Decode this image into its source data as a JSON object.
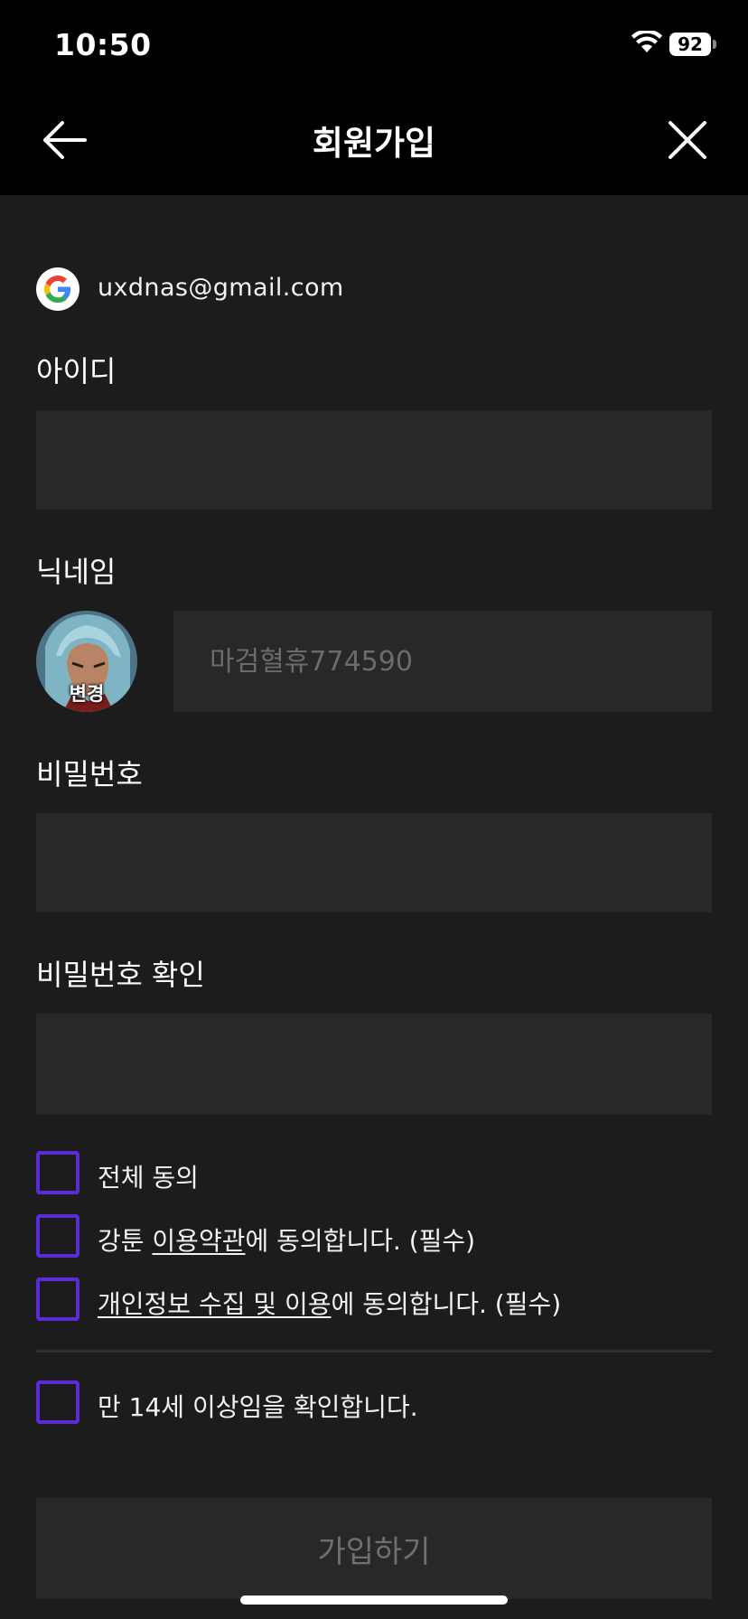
{
  "status": {
    "time": "10:50",
    "battery": "92"
  },
  "nav": {
    "title": "회원가입"
  },
  "account": {
    "email": "uxdnas@gmail.com"
  },
  "fields": {
    "id_label": "아이디",
    "nickname_label": "닉네임",
    "nickname_placeholder": "마검혈휴774590",
    "avatar_change": "변경",
    "password_label": "비밀번호",
    "password_confirm_label": "비밀번호 확인"
  },
  "agreements": {
    "all": "전체 동의",
    "terms_prefix": "강툰 ",
    "terms_link": "이용약관",
    "terms_suffix": "에 동의합니다. (필수)",
    "privacy_link": "개인정보 수집 및 이용",
    "privacy_suffix": "에 동의합니다. (필수)",
    "age": "만 14세 이상임을 확인합니다."
  },
  "submit": {
    "label": "가입하기"
  },
  "colors": {
    "checkbox_border": "#5b2bd6",
    "background": "#1c1c1d",
    "field": "#282829"
  }
}
